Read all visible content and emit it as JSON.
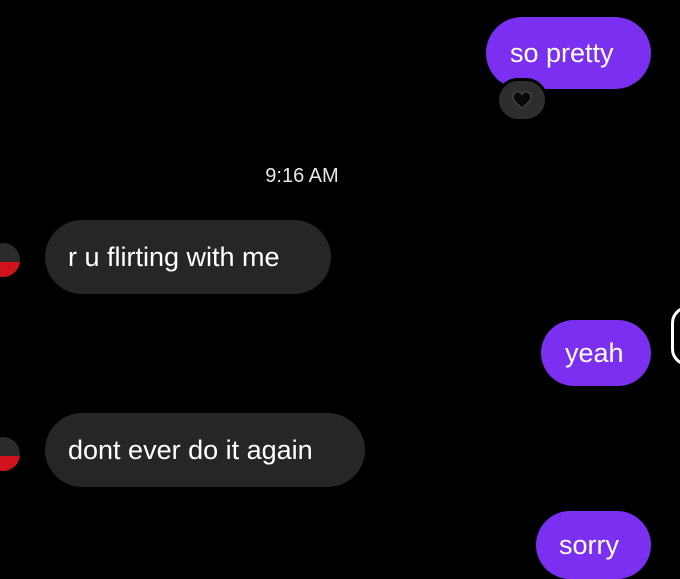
{
  "chat": {
    "timestamp": "9:16 AM",
    "messages": [
      {
        "sender": "me",
        "text": "so pretty",
        "reaction": "black-heart"
      },
      {
        "sender": "other",
        "text": "r u flirting with me"
      },
      {
        "sender": "me",
        "text": "yeah"
      },
      {
        "sender": "other",
        "text": "dont ever do it again"
      },
      {
        "sender": "me",
        "text": "sorry"
      }
    ]
  },
  "colors": {
    "background": "#000000",
    "sent_bubble": "#7b2ff0",
    "received_bubble": "#262626",
    "text": "#ffffff",
    "reaction_bg": "#2e2e2e",
    "avatar_accent": "#d0121b"
  }
}
